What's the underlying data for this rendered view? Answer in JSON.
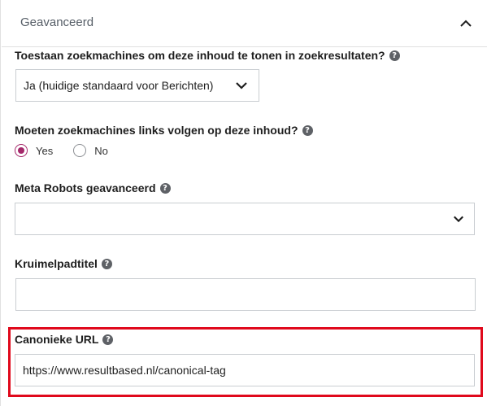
{
  "section": {
    "title": "Geavanceerd",
    "collapse_icon": "chevron-up-icon"
  },
  "search_visibility": {
    "label": "Toestaan zoekmachines om deze inhoud te tonen in zoekresultaten?",
    "help": "?",
    "selected": "Ja (huidige standaard voor Berichten)"
  },
  "follow_links": {
    "label": "Moeten zoekmachines links volgen op deze inhoud?",
    "help": "?",
    "options": [
      {
        "label": "Yes",
        "checked": true
      },
      {
        "label": "No",
        "checked": false
      }
    ]
  },
  "meta_robots": {
    "label": "Meta Robots geavanceerd",
    "help": "?",
    "selected": ""
  },
  "breadcrumb_title": {
    "label": "Kruimelpadtitel",
    "help": "?",
    "value": ""
  },
  "canonical_url": {
    "label": "Canonieke URL",
    "help": "?",
    "value": "https://www.resultbased.nl/canonical-tag"
  },
  "colors": {
    "accent": "#a4286a",
    "highlight": "#e0091c",
    "border": "#c9cdd1"
  }
}
